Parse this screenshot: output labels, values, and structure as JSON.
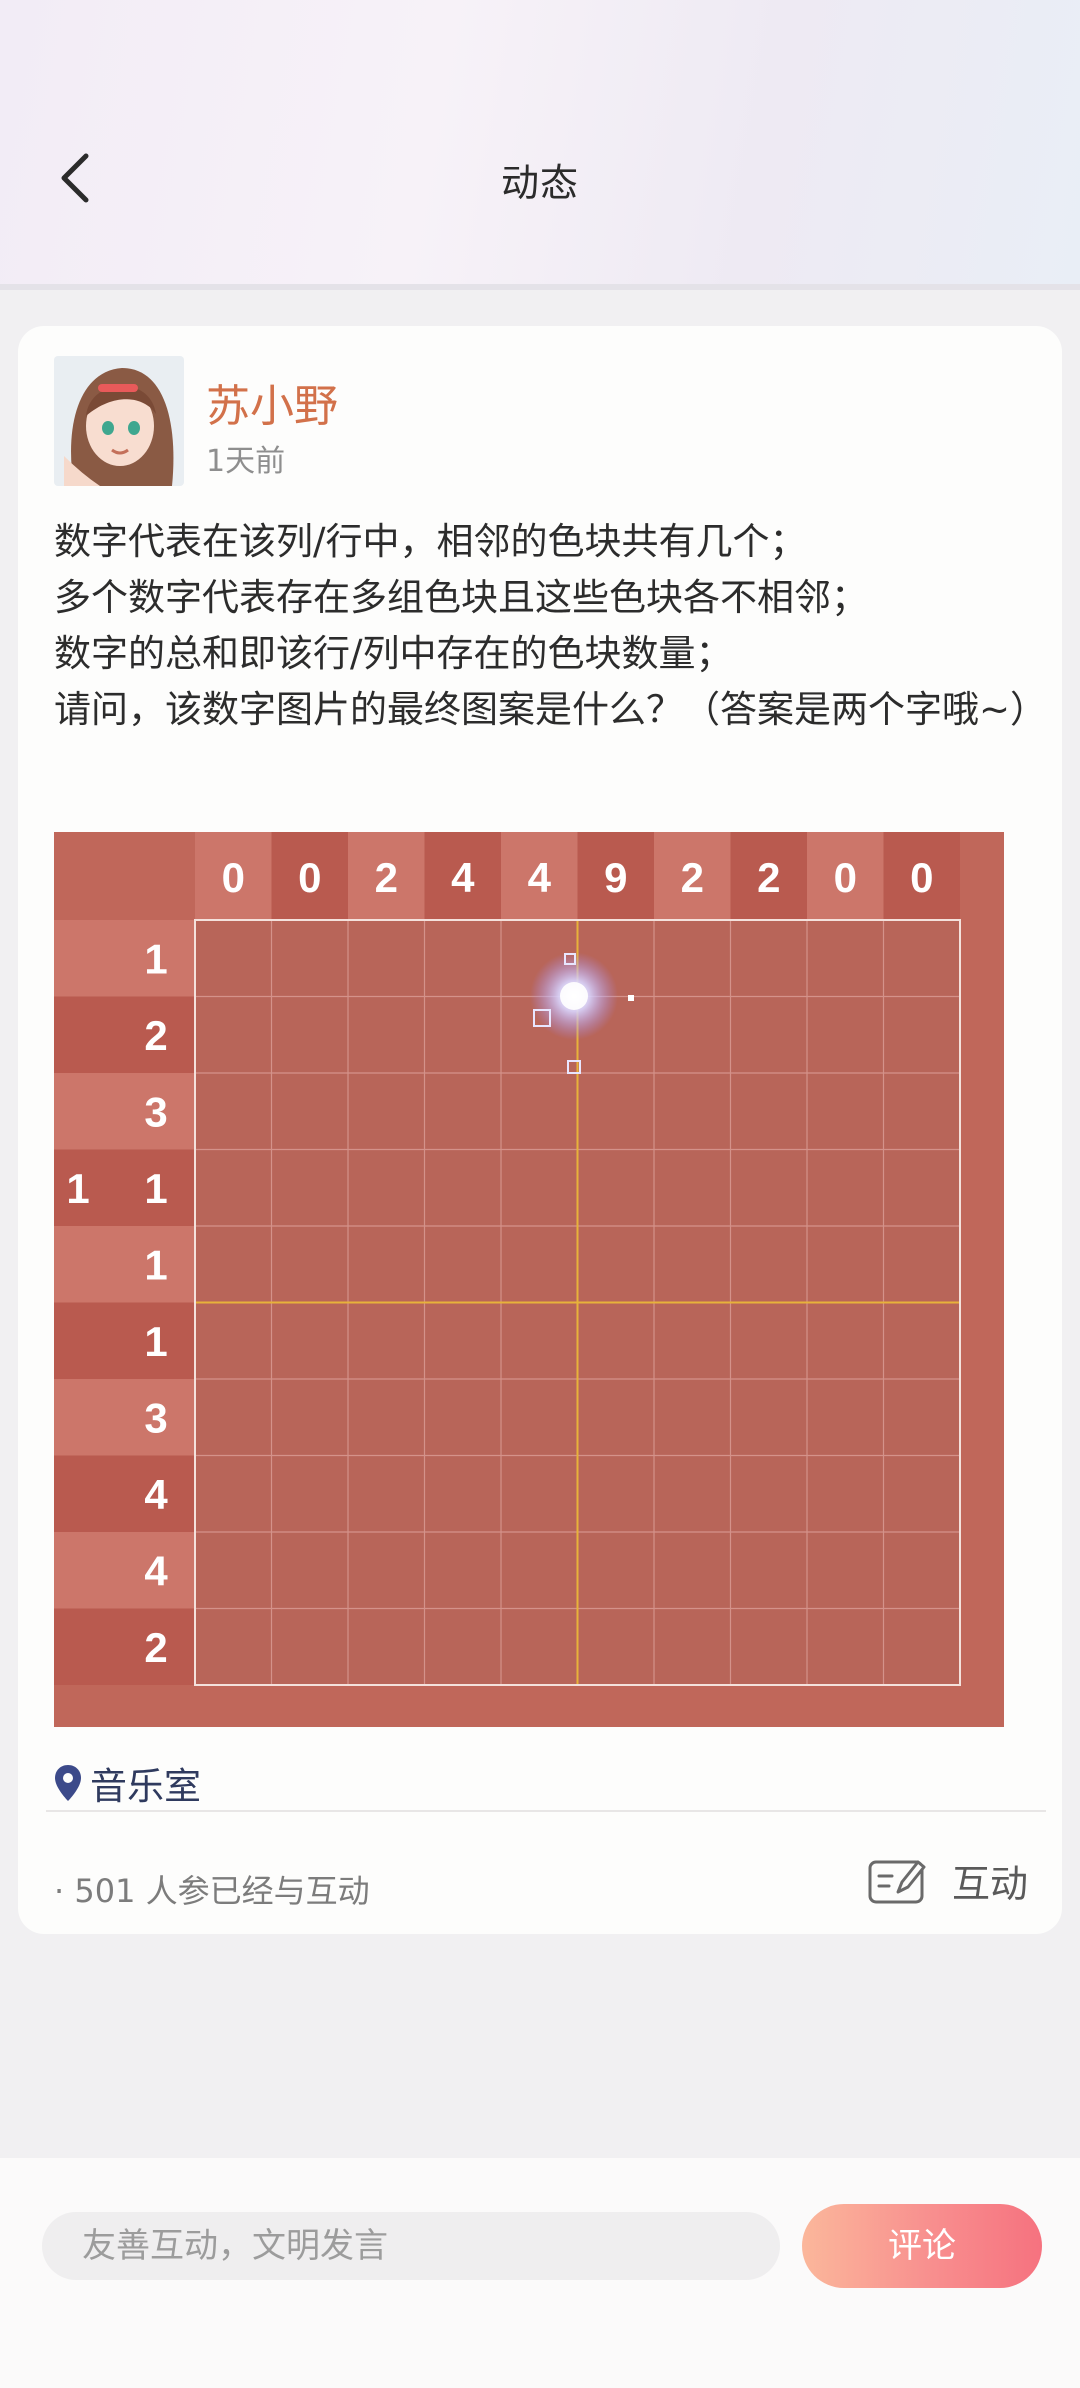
{
  "header": {
    "title": "动态",
    "back_icon": "chevron-left-icon"
  },
  "post": {
    "author": "苏小野",
    "time": "1天前",
    "lines": [
      "数字代表在该列/行中，相邻的色块共有几个；",
      "多个数字代表存在多组色块且这些色块各不相邻；",
      "数字的总和即该行/列中存在的色块数量；",
      "请问，该数字图片的最终图案是什么？（答案是两个字哦~）"
    ],
    "location": "音乐室",
    "participants": "· 501  人参已经与互动",
    "interact_label": "互动",
    "icons": {
      "location": "location-pin-icon",
      "interact": "edit-card-icon"
    }
  },
  "puzzle": {
    "column_clues": [
      "0",
      "0",
      "2",
      "4",
      "4",
      "9",
      "2",
      "2",
      "0",
      "0"
    ],
    "row_clues": [
      [
        "1"
      ],
      [
        "2"
      ],
      [
        "3"
      ],
      [
        "1",
        "1"
      ],
      [
        "1"
      ],
      [
        "1"
      ],
      [
        "3"
      ],
      [
        "4"
      ],
      [
        "4"
      ],
      [
        "2"
      ]
    ]
  },
  "comment": {
    "placeholder": "友善互动，文明发言",
    "button_label": "评论"
  },
  "colors": {
    "accent": "#d2714a",
    "grid_bg": "#c0675a",
    "button_start": "#fbb79b",
    "button_end": "#f6727f"
  }
}
